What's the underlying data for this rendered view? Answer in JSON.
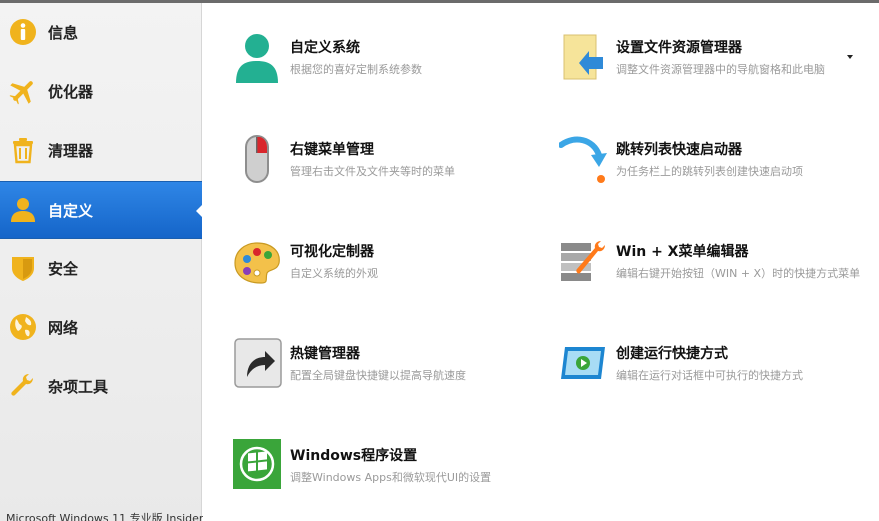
{
  "sidebar": {
    "items": [
      {
        "label": "信息",
        "icon": "info-icon"
      },
      {
        "label": "优化器",
        "icon": "airplane-icon"
      },
      {
        "label": "清理器",
        "icon": "trash-icon"
      },
      {
        "label": "自定义",
        "icon": "user-icon",
        "active": true
      },
      {
        "label": "安全",
        "icon": "shield-icon"
      },
      {
        "label": "网络",
        "icon": "globe-icon"
      },
      {
        "label": "杂项工具",
        "icon": "wrench-icon"
      }
    ],
    "footer": "Microsoft Windows 11 专业版 Insider"
  },
  "tiles": [
    {
      "title": "自定义系统",
      "desc": "根据您的喜好定制系统参数",
      "icon": "person-icon"
    },
    {
      "title": "设置文件资源管理器",
      "desc": "调整文件资源管理器中的导航窗格和此电脑",
      "icon": "folder-arrow-icon"
    },
    {
      "title": "右键菜单管理",
      "desc": "管理右击文件及文件夹等时的菜单",
      "icon": "mouse-icon"
    },
    {
      "title": "跳转列表快速启动器",
      "desc": "为任务栏上的跳转列表创建快速启动项",
      "icon": "jump-arrow-icon"
    },
    {
      "title": "可视化定制器",
      "desc": "自定义系统的外观",
      "icon": "palette-icon"
    },
    {
      "title": "Win + X菜单编辑器",
      "desc": "编辑右键开始按钮（WIN + X）时的快捷方式菜单",
      "icon": "menu-wrench-icon"
    },
    {
      "title": "热键管理器",
      "desc": "配置全局键盘快捷键以提高导航速度",
      "icon": "shortcut-key-icon"
    },
    {
      "title": "创建运行快捷方式",
      "desc": "编辑在运行对话框中可执行的快捷方式",
      "icon": "run-window-icon"
    },
    {
      "title": "Windows程序设置",
      "desc": "调整Windows Apps和微软现代UI的设置",
      "icon": "windows-logo-icon"
    }
  ],
  "colors": {
    "sidebar_active": "#1f74d8",
    "icon_yellow": "#f0b31d",
    "icon_green": "#23b092"
  }
}
